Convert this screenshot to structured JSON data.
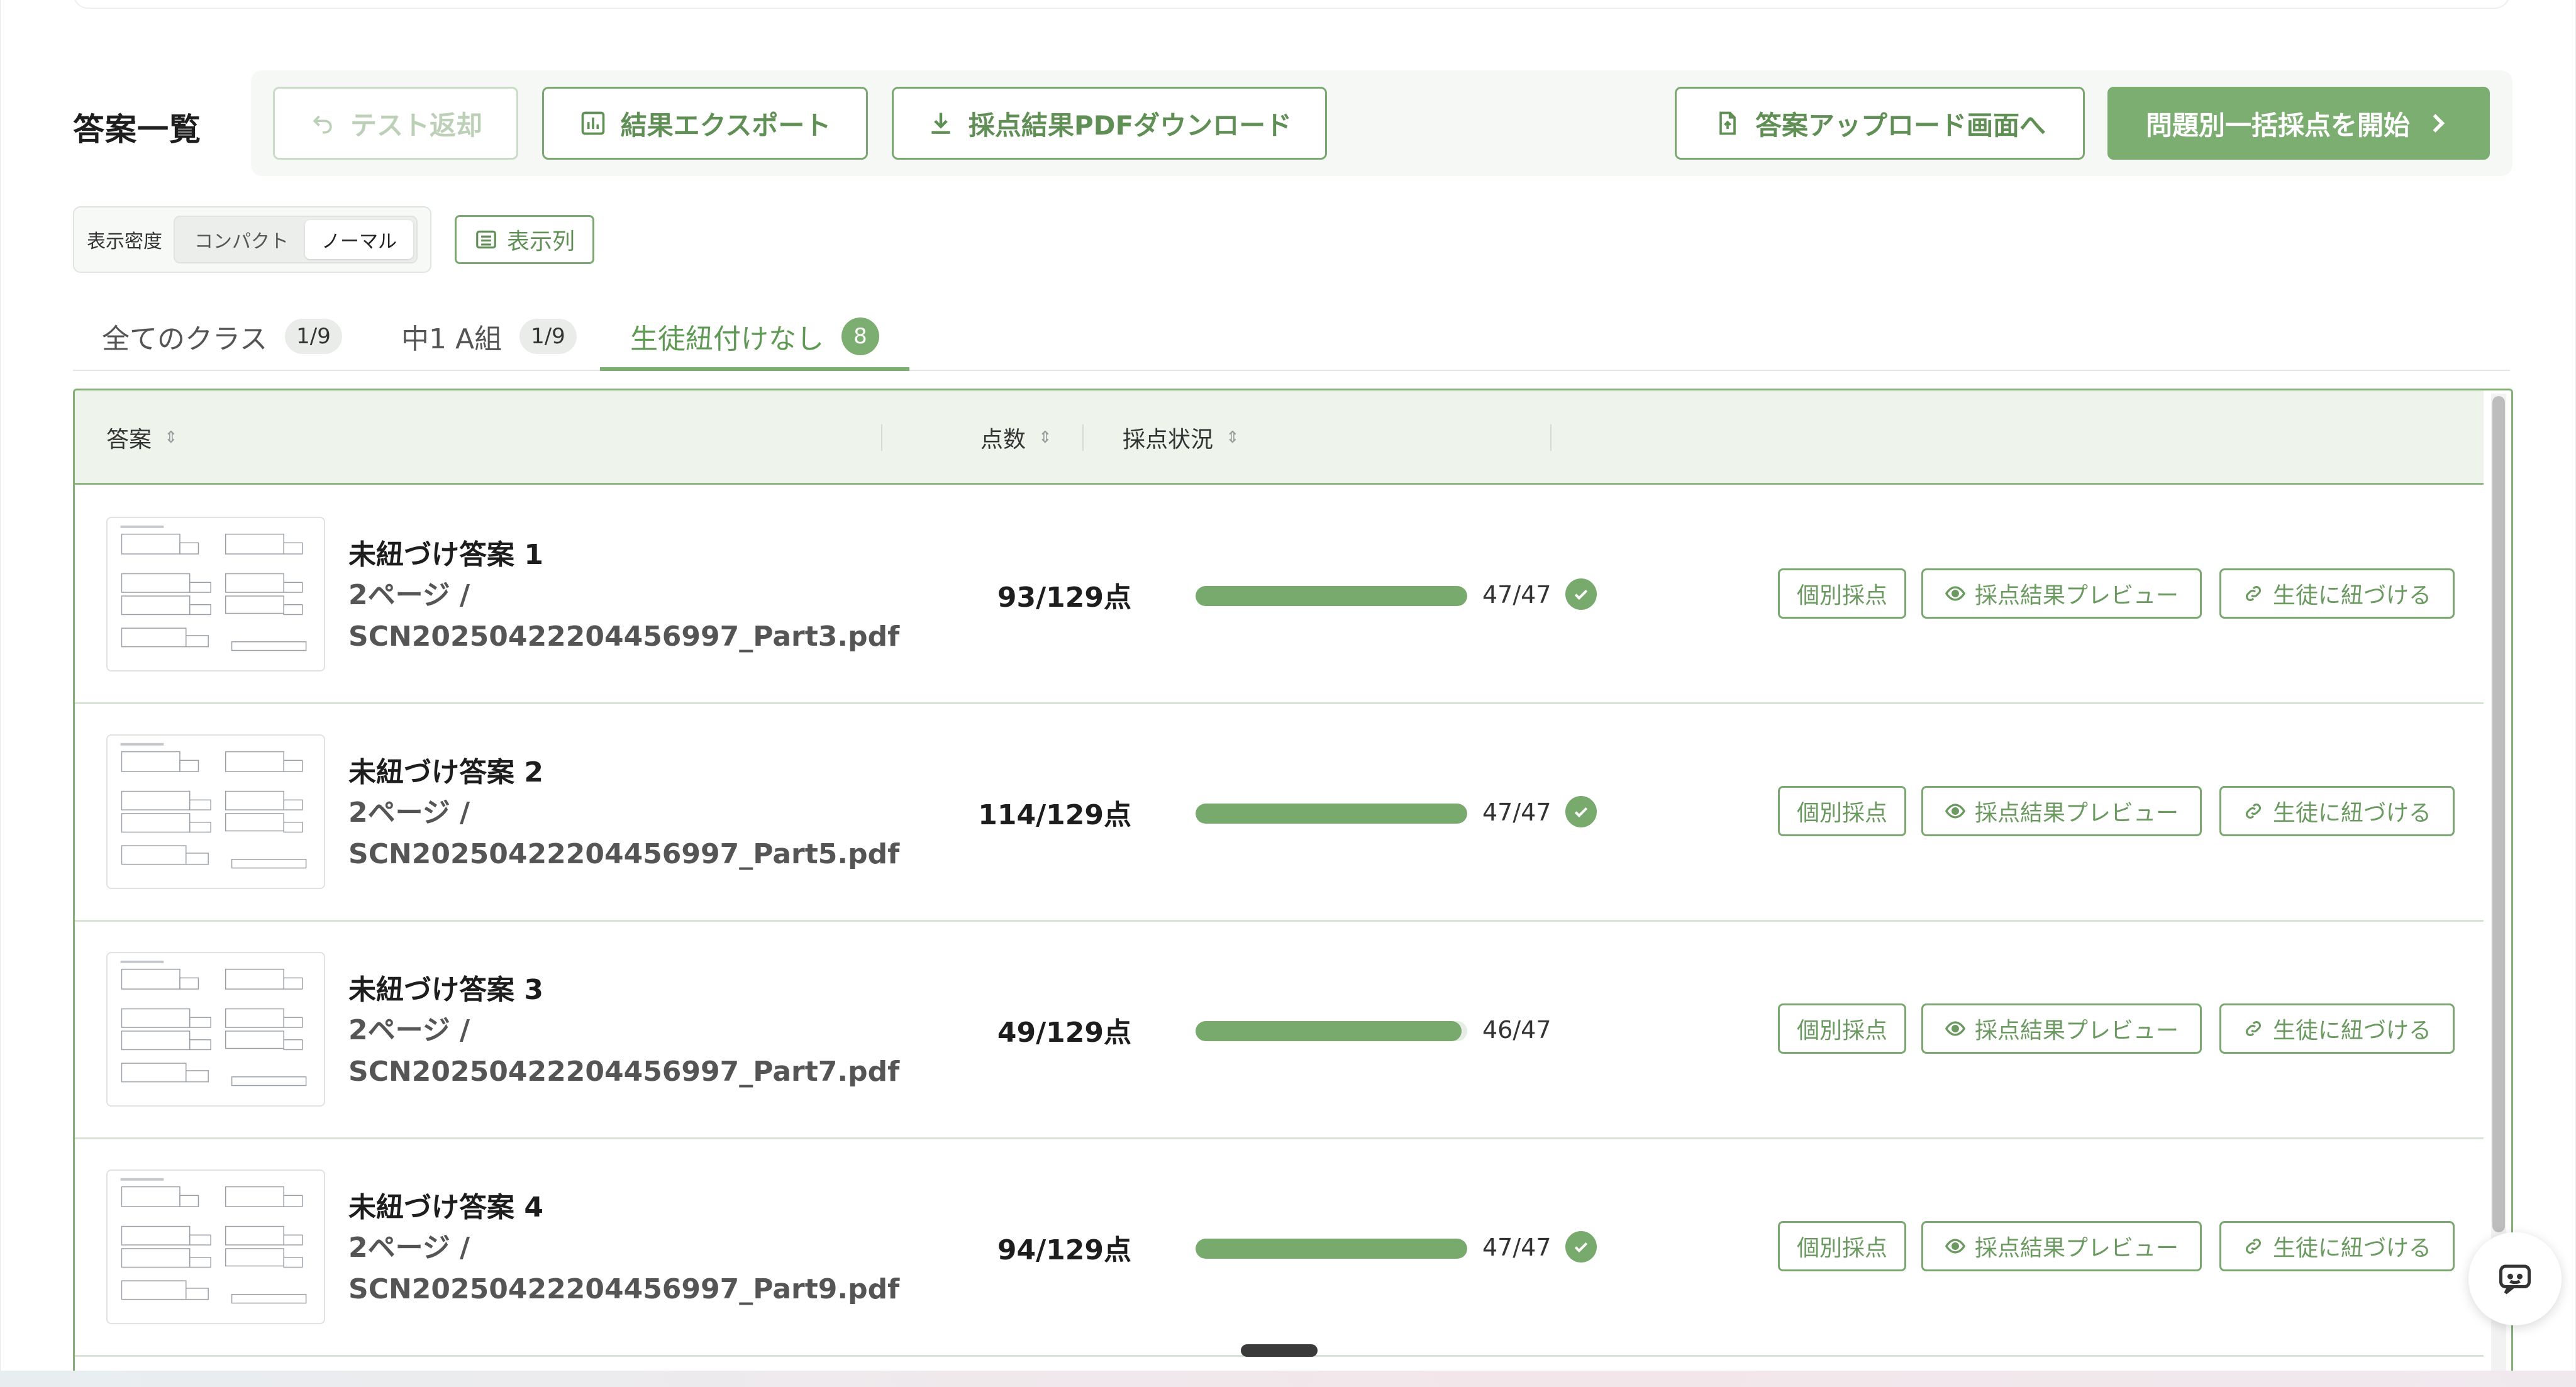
{
  "header": {
    "title": "答案一覧",
    "buttons": {
      "return_test": "テスト返却",
      "export": "結果エクスポート",
      "pdf_download": "採点結果PDFダウンロード",
      "upload": "答案アップロード画面へ",
      "start_bulk": "問題別一括採点を開始"
    }
  },
  "density": {
    "label": "表示密度",
    "options": [
      "コンパクト",
      "ノーマル"
    ],
    "selected": "ノーマル"
  },
  "columns_button": "表示列",
  "tabs": [
    {
      "label": "全てのクラス",
      "badge": "1/9"
    },
    {
      "label": "中1 A組",
      "badge": "1/9"
    },
    {
      "label": "生徒紐付けなし",
      "badge": "8",
      "active": true
    }
  ],
  "table": {
    "headers": {
      "answer": "答案",
      "score": "点数",
      "status": "採点状況"
    },
    "row_actions": {
      "individual": "個別採点",
      "preview": "採点結果プレビュー",
      "link": "生徒に紐づける"
    },
    "rows": [
      {
        "title": "未紐づけ答案 1",
        "pages": "2ページ /",
        "file": "SCN20250422204456997_Part3.pdf",
        "score": "93/129点",
        "graded": 47,
        "total": 47,
        "count": "47/47",
        "complete": true
      },
      {
        "title": "未紐づけ答案 2",
        "pages": "2ページ /",
        "file": "SCN20250422204456997_Part5.pdf",
        "score": "114/129点",
        "graded": 47,
        "total": 47,
        "count": "47/47",
        "complete": true
      },
      {
        "title": "未紐づけ答案 3",
        "pages": "2ページ /",
        "file": "SCN20250422204456997_Part7.pdf",
        "score": "49/129点",
        "graded": 46,
        "total": 47,
        "count": "46/47",
        "complete": false
      },
      {
        "title": "未紐づけ答案 4",
        "pages": "2ページ /",
        "file": "SCN20250422204456997_Part9.pdf",
        "score": "94/129点",
        "graded": 47,
        "total": 47,
        "count": "47/47",
        "complete": true
      }
    ]
  },
  "colors": {
    "accent": "#7cae71",
    "accent_text": "#5f8f55",
    "disabled": "#c9dcc5"
  }
}
